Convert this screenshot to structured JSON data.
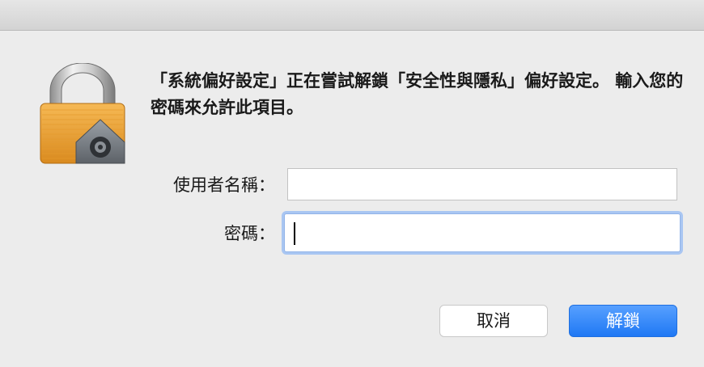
{
  "dialog": {
    "message": "「系統偏好設定」正在嘗試解鎖「安全性與隱私」偏好設定。 輸入您的密碼來允許此項目。",
    "lock_icon": "padlock-icon"
  },
  "form": {
    "username_label": "使用者名稱：",
    "username_value": "_______",
    "password_label": "密碼：",
    "password_value": ""
  },
  "buttons": {
    "cancel_label": "取消",
    "unlock_label": "解鎖"
  },
  "colors": {
    "accent": "#1f78f4",
    "focus_ring": "#a9c6f2",
    "background": "#ececec"
  }
}
